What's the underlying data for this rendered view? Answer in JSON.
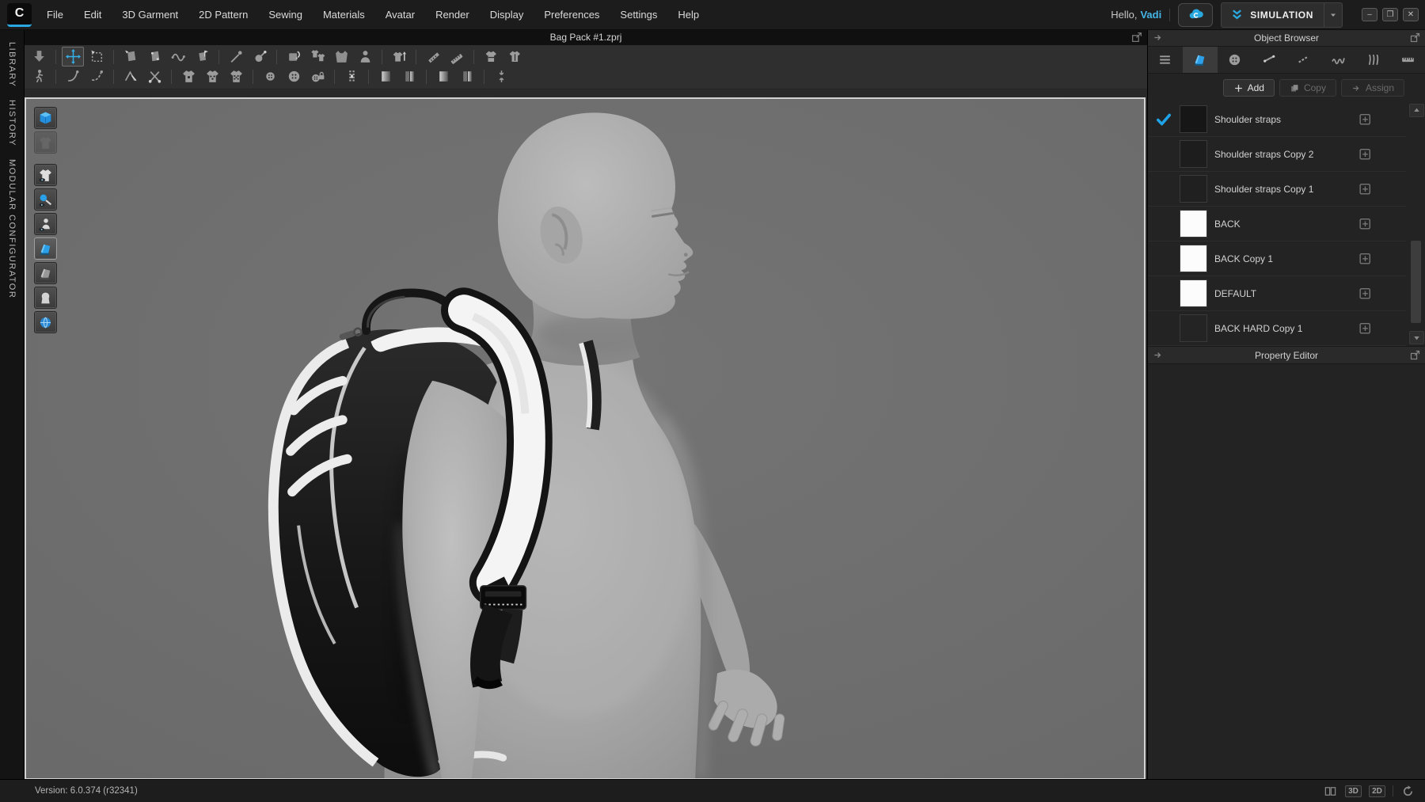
{
  "app": {
    "logo_letter": "C"
  },
  "menu_bar": {
    "items": [
      "File",
      "Edit",
      "3D Garment",
      "2D Pattern",
      "Sewing",
      "Materials",
      "Avatar",
      "Render",
      "Display",
      "Preferences",
      "Settings",
      "Help"
    ],
    "greeting_prefix": "Hello,",
    "greeting_name": "Vadi",
    "simulation_label": "SIMULATION",
    "window_controls": [
      {
        "name": "minimize-button",
        "glyph": "–"
      },
      {
        "name": "restore-button",
        "glyph": "❐"
      },
      {
        "name": "close-button",
        "glyph": "✕"
      }
    ]
  },
  "left_rail": {
    "tabs": [
      {
        "name": "rail-tab-library",
        "label": "LIBRARY"
      },
      {
        "name": "rail-tab-history",
        "label": "HISTORY"
      },
      {
        "name": "rail-tab-modular-configurator",
        "label": "MODULAR CONFIGURATOR"
      }
    ]
  },
  "document_tab": {
    "title": "Bag Pack #1.zprj"
  },
  "toolbar": {
    "row1": [
      {
        "name": "simulate-tool",
        "icon": "arrow-down"
      },
      {
        "sep": true
      },
      {
        "name": "select-move-tool",
        "icon": "move",
        "active": true
      },
      {
        "name": "select-box-tool",
        "icon": "marquee"
      },
      {
        "sep": true
      },
      {
        "name": "move-pattern-tool",
        "icon": "pattern-arrow"
      },
      {
        "name": "edit-pattern-tool",
        "icon": "pattern-dots"
      },
      {
        "name": "edit-curve-tool",
        "icon": "wave"
      },
      {
        "name": "flatten-pattern-tool",
        "icon": "pattern-flag"
      },
      {
        "sep": true
      },
      {
        "name": "pin-tool",
        "icon": "needle"
      },
      {
        "name": "spray-pin-tool",
        "icon": "spray"
      },
      {
        "sep": true
      },
      {
        "name": "arrangement-tool",
        "icon": "arrange"
      },
      {
        "name": "reset-arrangement-tool",
        "icon": "shirts"
      },
      {
        "name": "bounding-volume-tool",
        "icon": "vest"
      },
      {
        "name": "arrangement-points-tool",
        "icon": "person"
      },
      {
        "sep": true
      },
      {
        "name": "fitting-suit-tool",
        "icon": "shirt-up"
      },
      {
        "sep": true
      },
      {
        "name": "tape-measure-tool",
        "icon": "tape"
      },
      {
        "name": "attach-tape-tool",
        "icon": "ruler-pen"
      },
      {
        "sep": true
      },
      {
        "name": "stretch-garment-h-tool",
        "icon": "shirt-h"
      },
      {
        "name": "stretch-garment-v-tool",
        "icon": "shirt-v"
      }
    ],
    "row2": [
      {
        "name": "walkthrough-tool",
        "icon": "walk"
      },
      {
        "sep": true
      },
      {
        "name": "segment-sewing-tool",
        "icon": "sew-seg"
      },
      {
        "name": "free-sewing-tool",
        "icon": "sew-free"
      },
      {
        "sep": true
      },
      {
        "name": "edit-sewing-tool",
        "icon": "sew-edit"
      },
      {
        "name": "detach-sewing-tool",
        "icon": "scissors-x"
      },
      {
        "sep": true
      },
      {
        "name": "pleats-sewing-tool",
        "icon": "shirt-dot"
      },
      {
        "name": "fold-arrangement-tool",
        "icon": "shirt-dots"
      },
      {
        "name": "fold-3d-pattern-tool",
        "icon": "shirt-grid"
      },
      {
        "sep": true
      },
      {
        "name": "button-tool",
        "icon": "button-sm"
      },
      {
        "name": "buttonhole-tool",
        "icon": "button-lg"
      },
      {
        "name": "fasten-button-tool",
        "icon": "button-lock"
      },
      {
        "sep": true
      },
      {
        "name": "zipper-tool",
        "icon": "zipper"
      },
      {
        "sep": true
      },
      {
        "name": "fold-angle-a-tool",
        "icon": "fold-a"
      },
      {
        "name": "fold-angle-b-tool",
        "icon": "fold-b"
      },
      {
        "sep": true
      },
      {
        "name": "smooth-fold-a-tool",
        "icon": "fold-a"
      },
      {
        "name": "smooth-fold-b-tool",
        "icon": "fold-b"
      },
      {
        "sep": true
      },
      {
        "name": "pressure-tool",
        "icon": "pressure"
      }
    ]
  },
  "viewport": {
    "background": "#6f6f6f",
    "tools": [
      {
        "name": "show-3d-garment-toggle",
        "icon": "box3d"
      },
      {
        "name": "show-2d-pattern-toggle",
        "icon": "shirt-ghost",
        "disabled": true
      },
      {
        "name": "show-garment-toggle",
        "icon": "shirt-eye",
        "gap": true
      },
      {
        "name": "show-pins-toggle",
        "icon": "sphere-pen"
      },
      {
        "name": "show-avatar-toggle",
        "icon": "bust-eye"
      },
      {
        "name": "textured-surface-toggle",
        "icon": "fabric-blue",
        "active": true
      },
      {
        "name": "thick-textured-surface-toggle",
        "icon": "fabric-gray"
      },
      {
        "name": "show-avatar-head-toggle",
        "icon": "head"
      },
      {
        "name": "show-environment-toggle",
        "icon": "globe"
      }
    ]
  },
  "object_browser": {
    "title": "Object Browser",
    "tabs": [
      {
        "name": "tab-scene-list",
        "icon": "list"
      },
      {
        "name": "tab-fabric",
        "icon": "fabric-blue",
        "active": true
      },
      {
        "name": "tab-button",
        "icon": "button-lg"
      },
      {
        "name": "tab-seam",
        "icon": "seam-line"
      },
      {
        "name": "tab-stitch",
        "icon": "seam-dash"
      },
      {
        "name": "tab-topstitch",
        "icon": "topstitch"
      },
      {
        "name": "tab-puckering",
        "icon": "puckering"
      },
      {
        "name": "tab-measure",
        "icon": "measure"
      }
    ],
    "actions": [
      {
        "name": "add-button",
        "label": "Add",
        "icon": "plus",
        "enabled": true
      },
      {
        "name": "copy-button",
        "label": "Copy",
        "icon": "copy",
        "enabled": false
      },
      {
        "name": "assign-button",
        "label": "Assign",
        "icon": "assign",
        "enabled": false
      }
    ],
    "items": [
      {
        "label": "Shoulder straps",
        "checked": true,
        "swatch": "#161616"
      },
      {
        "label": "Shoulder straps Copy 2",
        "swatch": "#1d1d1d"
      },
      {
        "label": "Shoulder straps Copy 1",
        "swatch": "#202020"
      },
      {
        "label": "BACK",
        "swatch": "#fcfcfc"
      },
      {
        "label": "BACK Copy 1",
        "swatch": "#fcfcfc"
      },
      {
        "label": "DEFAULT",
        "swatch": "#fcfcfc"
      },
      {
        "label": "BACK HARD Copy 1",
        "swatch": "#242424"
      }
    ]
  },
  "property_editor": {
    "title": "Property Editor"
  },
  "status_bar": {
    "version": "Version: 6.0.374 (r32341)",
    "view_buttons": [
      {
        "name": "view-3d-button",
        "label": "3D"
      },
      {
        "name": "view-2d-button",
        "label": "2D"
      }
    ]
  },
  "colors": {
    "accent_blue": "#2aa7e0",
    "check_blue": "#1fa3e8",
    "viewport_bg": "#6f6f6f",
    "avatar_gray": "#a9a9a9",
    "bag_black": "#1a1a1a",
    "trim_white": "#eeeeee"
  }
}
